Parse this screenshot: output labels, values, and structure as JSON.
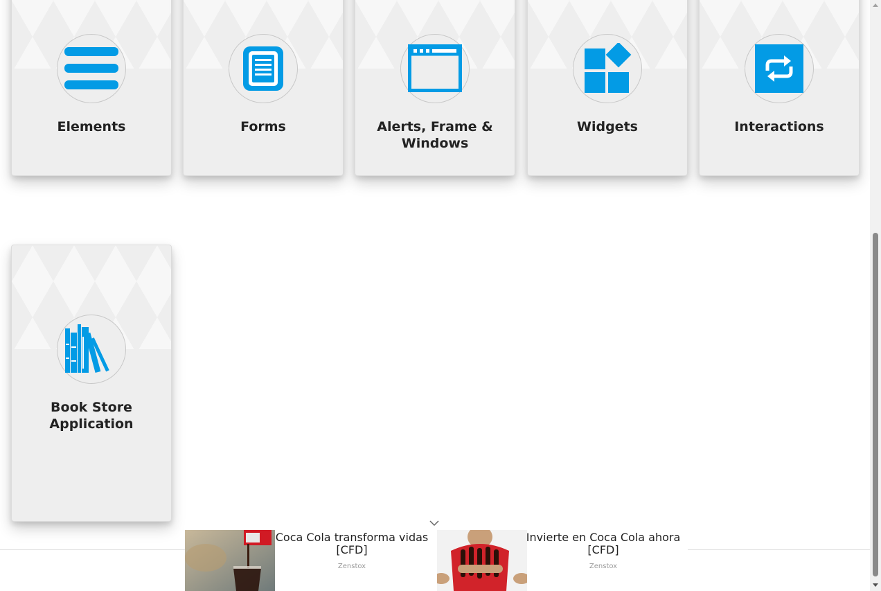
{
  "cards": [
    {
      "label": "Elements",
      "icon": "list-icon"
    },
    {
      "label": "Forms",
      "icon": "form-icon"
    },
    {
      "label": "Alerts, Frame & Windows",
      "icon": "window-icon"
    },
    {
      "label": "Widgets",
      "icon": "widgets-icon"
    },
    {
      "label": "Interactions",
      "icon": "interactions-icon"
    },
    {
      "label": "Book Store Application",
      "icon": "books-icon"
    }
  ],
  "ads": [
    {
      "text": "Coca Cola transforma vidas [CFD]",
      "source": "Zenstox"
    },
    {
      "text": "Invierte en Coca Cola ahora [CFD]",
      "source": "Zenstox"
    }
  ],
  "colors": {
    "accent": "#039be5",
    "card_bg": "#eeeeee"
  }
}
